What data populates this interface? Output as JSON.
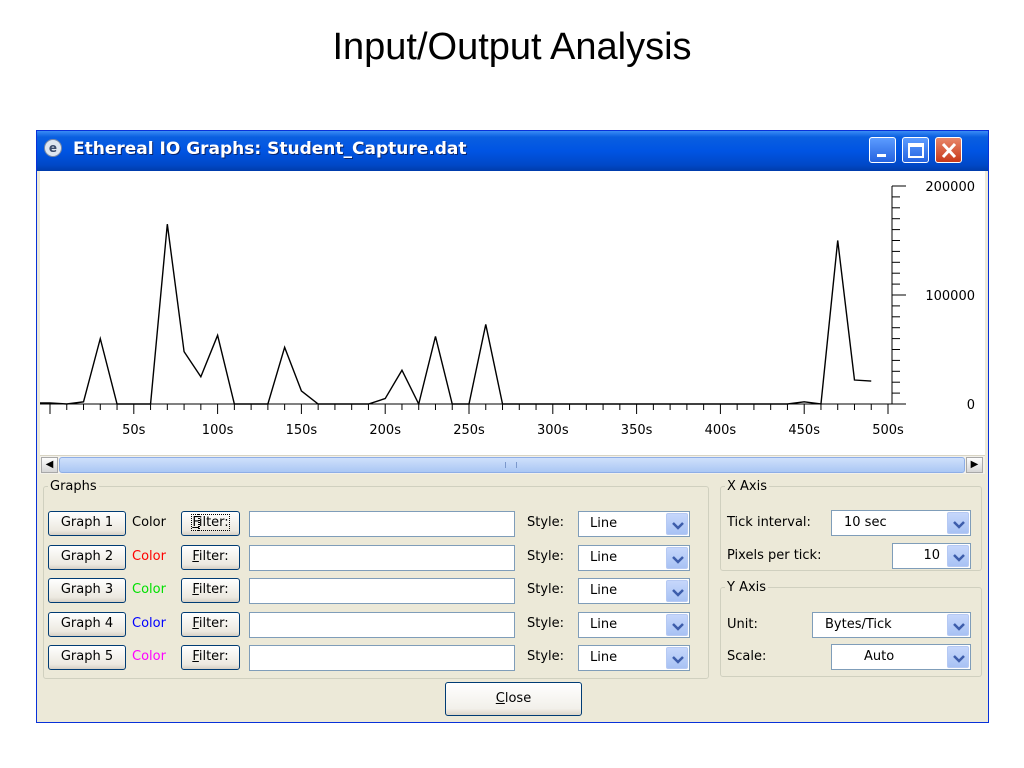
{
  "slide": {
    "title": "Input/Output Analysis"
  },
  "window": {
    "title": "Ethereal IO Graphs: Student_Capture.dat",
    "icon": "ethereal-app-icon",
    "controls": {
      "minimize": "minimize-icon",
      "maximize": "maximize-icon",
      "close": "close-icon"
    }
  },
  "chart_data": {
    "type": "line",
    "title": "",
    "xlabel": "",
    "ylabel": "",
    "xlim": [
      0,
      500
    ],
    "ylim": [
      0,
      200000
    ],
    "x_tick_labels": [
      "50s",
      "100s",
      "150s",
      "200s",
      "250s",
      "300s",
      "350s",
      "400s",
      "450s",
      "500s"
    ],
    "y_tick_labels": [
      "200000",
      "100000",
      "0"
    ],
    "grid": false,
    "line_color": "#000000",
    "series": [
      {
        "x": [
          0,
          10,
          20,
          30,
          40,
          50,
          60,
          70,
          80,
          90,
          100,
          110,
          120,
          130,
          140,
          150,
          160,
          170,
          180,
          190,
          200,
          210,
          220,
          230,
          240,
          250,
          260,
          270,
          280,
          290,
          300,
          310,
          320,
          330,
          340,
          350,
          360,
          370,
          380,
          390,
          400,
          410,
          420,
          430,
          440,
          450,
          460,
          470,
          480,
          490
        ],
        "y": [
          1000,
          0,
          2000,
          60000,
          0,
          0,
          0,
          165000,
          48000,
          25000,
          63000,
          0,
          0,
          0,
          52000,
          12000,
          0,
          0,
          0,
          0,
          5000,
          31000,
          0,
          62000,
          0,
          0,
          73000,
          0,
          0,
          0,
          0,
          0,
          0,
          0,
          0,
          0,
          0,
          0,
          0,
          0,
          0,
          0,
          0,
          0,
          0,
          2000,
          0,
          150000,
          22000,
          21000
        ]
      }
    ]
  },
  "scrollbar": {
    "left_arrow": "◀",
    "right_arrow": "▶"
  },
  "graphs_panel": {
    "legend": "Graphs",
    "color_label": "Color",
    "filter_label_key": "F",
    "filter_label_rest": "ilter:",
    "style_label": "Style:",
    "rows": [
      {
        "button": "Graph 1",
        "color": "#000000",
        "filter": "",
        "style": "Line"
      },
      {
        "button": "Graph 2",
        "color": "#ff0000",
        "filter": "",
        "style": "Line"
      },
      {
        "button": "Graph 3",
        "color": "#00e000",
        "filter": "",
        "style": "Line"
      },
      {
        "button": "Graph 4",
        "color": "#0000ff",
        "filter": "",
        "style": "Line"
      },
      {
        "button": "Graph 5",
        "color": "#ff00ff",
        "filter": "",
        "style": "Line"
      }
    ]
  },
  "x_axis_panel": {
    "legend": "X Axis",
    "tick_interval_label": "Tick interval:",
    "tick_interval_value": "10 sec",
    "pixels_per_tick_label": "Pixels per tick:",
    "pixels_per_tick_value": "10"
  },
  "y_axis_panel": {
    "legend": "Y Axis",
    "unit_label": "Unit:",
    "unit_value": "Bytes/Tick",
    "scale_label": "Scale:",
    "scale_value": "Auto"
  },
  "close_button": {
    "key": "C",
    "rest": "lose"
  }
}
